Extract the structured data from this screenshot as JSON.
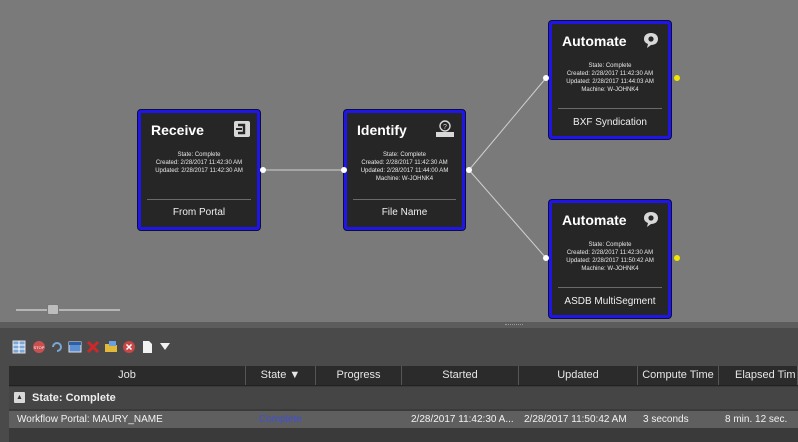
{
  "colors": {
    "canvas_bg": "#7a7a7a",
    "node_bg": "#262626",
    "node_border": "#1f16e6",
    "output_port_yellow": "#f2e600",
    "panel_bg": "#4a4a4a",
    "state_link": "#3f4fd9"
  },
  "nodes": {
    "receive": {
      "title": "Receive",
      "icon": "receive-icon",
      "lines": [
        "State: Complete",
        "Created: 2/28/2017 11:42:30 AM",
        "Updated: 2/28/2017 11:42:30 AM"
      ],
      "label": "From Portal"
    },
    "identify": {
      "title": "Identify",
      "icon": "identify-icon",
      "lines": [
        "State: Complete",
        "Created: 2/28/2017 11:42:30 AM",
        "Updated: 2/28/2017 11:44:00 AM",
        "Machine: W-JOHNK4"
      ],
      "label": "File Name"
    },
    "automate_top": {
      "title": "Automate",
      "icon": "chat-bubble-icon",
      "lines": [
        "State: Complete",
        "Created: 2/28/2017 11:42:30 AM",
        "Updated: 2/28/2017 11:44:03 AM",
        "Machine: W-JOHNK4"
      ],
      "label": "BXF Syndication"
    },
    "automate_bottom": {
      "title": "Automate",
      "icon": "chat-bubble-icon",
      "lines": [
        "State: Complete",
        "Created: 2/28/2017 11:42:30 AM",
        "Updated: 2/28/2017 11:50:42 AM",
        "Machine: W-JOHNK4"
      ],
      "label": "ASDB MultiSegment"
    }
  },
  "zoom_slider": {
    "level": 0.35
  },
  "toolbar": {
    "icons": [
      "grid-view-icon",
      "stop-icon",
      "refresh-icon",
      "window-icon",
      "delete-icon",
      "folder-icon",
      "cancel-icon",
      "document-icon",
      "filter-icon"
    ]
  },
  "grid": {
    "columns": {
      "job": "Job",
      "state": "State ▼",
      "progress": "Progress",
      "started": "Started",
      "updated": "Updated",
      "compute": "Compute Time",
      "elapsed": "Elapsed Tim"
    },
    "group_label": "State: Complete",
    "row": {
      "job": "Workflow Portal: MAURY_NAME",
      "state": "Complete",
      "started": "2/28/2017 11:42:30 A...",
      "updated": "2/28/2017 11:50:42 AM",
      "compute": "3 seconds",
      "elapsed": "8 min. 12 sec."
    }
  }
}
